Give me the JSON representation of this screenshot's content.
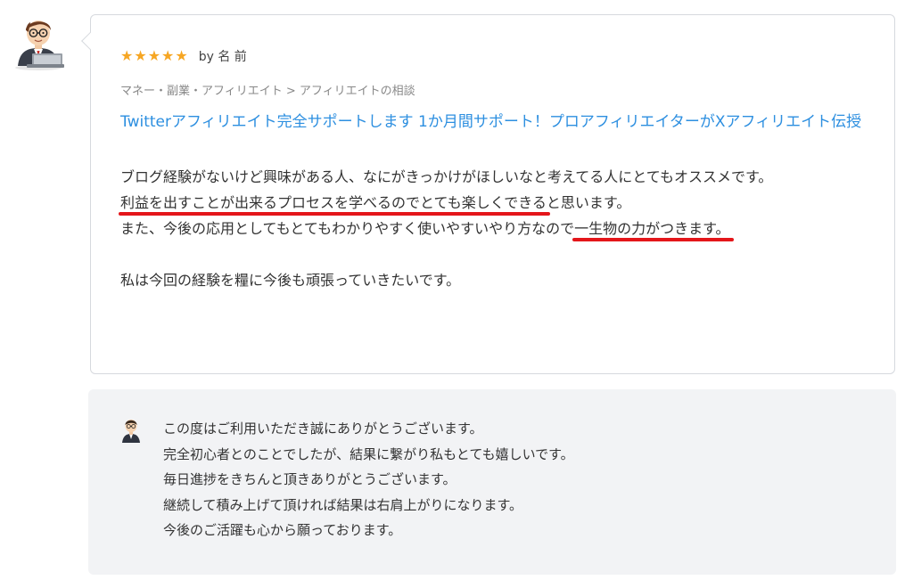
{
  "review": {
    "rating": 5,
    "reviewer": "by 名 前",
    "category": "マネー・副業・アフィリエイト > アフィリエイトの相談",
    "service_title": "Twitterアフィリエイト完全サポートします 1か月間サポート！プロアフィリエイターがXアフィリエイト伝授",
    "body": {
      "line1": "ブログ経験がないけど興味がある人、なにがきっかけがほしいなと考えてる人にとてもオススメです。",
      "line2_underlined": "利益を出すことが出来るプロセスを学べるのでとても楽しくできる",
      "line2_rest": "と思います。",
      "line3_start": "また、今後の応用としてもとてもわかりやすく使いやすいやり方なので",
      "line3_underlined": "一生物の力がつきます。",
      "line4": "私は今回の経験を糧に今後も頑張っていきたいです。"
    }
  },
  "reply": {
    "lines": [
      "この度はご利用いただき誠にありがとうございます。",
      "完全初心者とのことでしたが、結果に繋がり私もとても嬉しいです。",
      "毎日進捗をきちんと頂きありがとうございます。",
      "継続して積み上げて頂ければ結果は右肩上がりになります。",
      "今後のご活躍も心から願っております。"
    ]
  },
  "colors": {
    "star": "#f6a623",
    "link": "#2d8fe0",
    "underline": "#e4161a",
    "reply_bg": "#f2f3f5"
  },
  "icons": {
    "reviewer_avatar": "man-at-laptop-icon",
    "seller_avatar": "man-with-glasses-icon",
    "star": "star-icon"
  }
}
